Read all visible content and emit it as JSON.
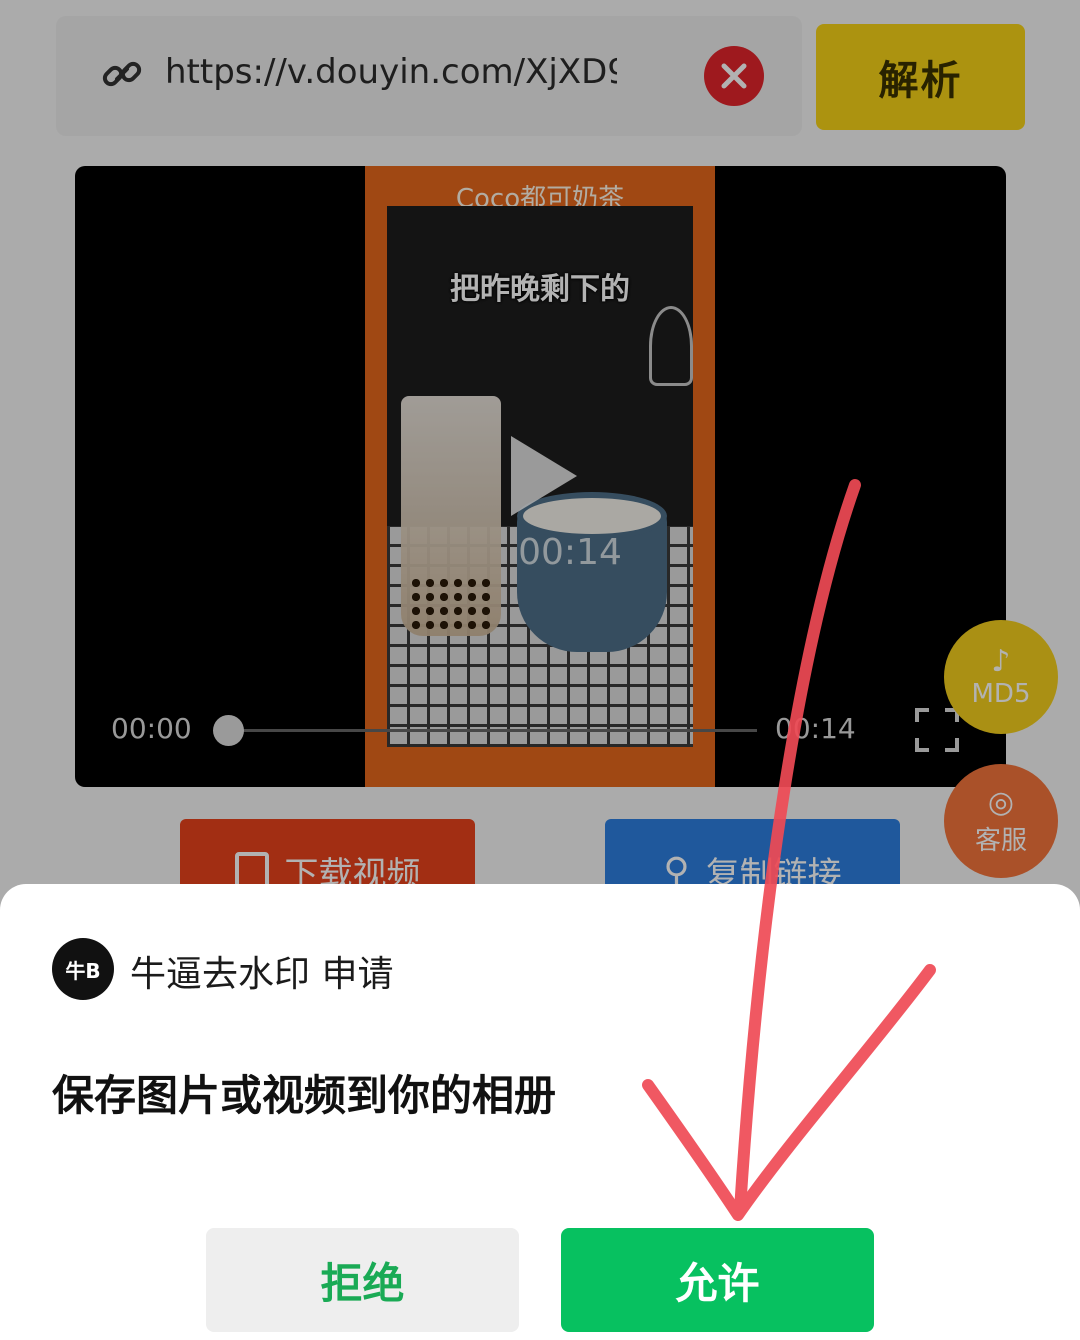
{
  "url_bar": {
    "value": "https://v.douyin.com/XjXD9",
    "link_icon": "link-icon",
    "clear_icon": "close-icon"
  },
  "parse_button": {
    "label": "解析"
  },
  "video": {
    "brand_text": "Coco都可奶茶",
    "caption": "把昨晚剩下的",
    "center_time": "00:14",
    "current_time": "00:00",
    "total_time": "00:14",
    "progress": 0,
    "play_icon": "play-icon",
    "fullscreen_icon": "fullscreen-icon"
  },
  "floating": {
    "md5_label": "MD5",
    "md5_icon": "tiktok-icon",
    "service_label": "客服",
    "service_icon": "headset-icon"
  },
  "actions": {
    "download_label": "下载视频",
    "copy_label": "复制链接"
  },
  "permission_sheet": {
    "app_name": "牛逼去水印 申请",
    "avatar_text": "牛B",
    "message": "保存图片或视频到你的相册",
    "deny_label": "拒绝",
    "allow_label": "允许"
  },
  "colors": {
    "parse_yellow": "#f6d318",
    "allow_green": "#07c160",
    "download_red": "#e8421c",
    "copy_blue": "#2d7fe0",
    "annotation_red": "#ef4a55"
  }
}
